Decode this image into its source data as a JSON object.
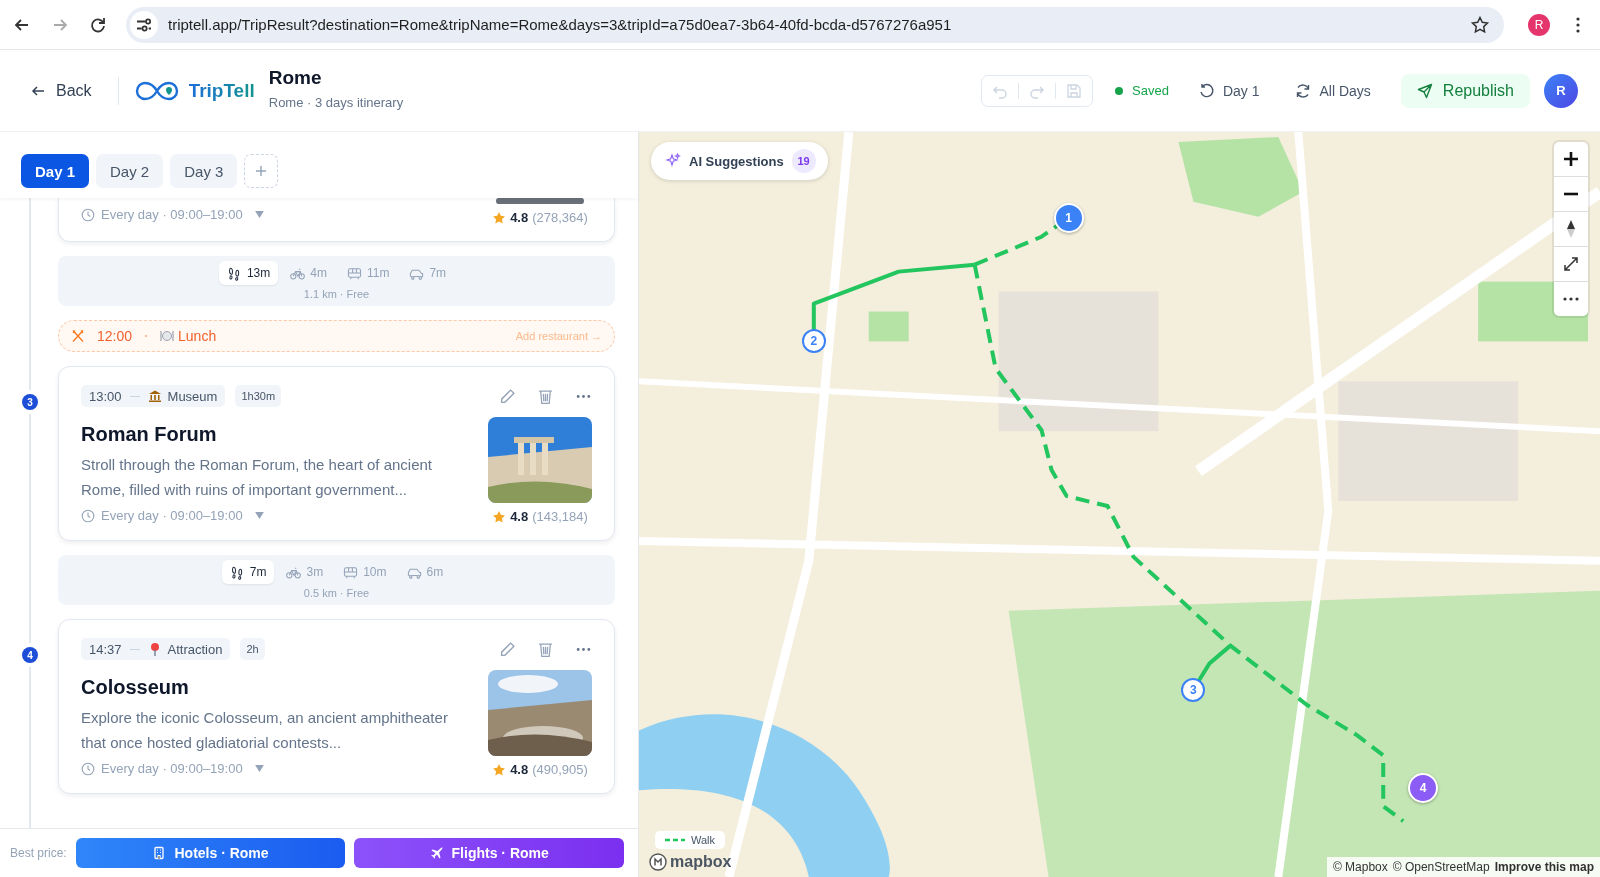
{
  "browser": {
    "url": "triptell.app/TripResult?destination=Rome&tripName=Rome&days=3&tripId=a75d0ea7-3b64-40fd-bcda-d5767276a951",
    "profile": "R"
  },
  "header": {
    "back": "Back",
    "brand": "TripTell",
    "title": "Rome",
    "subtitle": "Rome · 3 days itinerary",
    "saved": "Saved",
    "day": "Day 1",
    "all_days": "All Days",
    "publish": "Republish",
    "avatar": "R"
  },
  "day_tabs": [
    {
      "label": "Day 1",
      "selected": true
    },
    {
      "label": "Day 2",
      "selected": false
    },
    {
      "label": "Day 3",
      "selected": false
    }
  ],
  "itinerary": [
    {
      "kind": "place",
      "hours": "Every day · 09:00–19:00",
      "rating": "4.8",
      "reviews": "(278,364)"
    },
    {
      "kind": "transit",
      "summary": "1.1 km · Free",
      "modes": [
        {
          "kind": "walk",
          "time": "13m",
          "selected": true
        },
        {
          "kind": "bike",
          "time": "4m",
          "selected": false
        },
        {
          "kind": "bus",
          "time": "11m",
          "selected": false
        },
        {
          "kind": "car",
          "time": "7m",
          "selected": false
        }
      ]
    },
    {
      "kind": "meal",
      "time": "12:00",
      "label": "Lunch",
      "action": "Add restaurant →"
    },
    {
      "kind": "place",
      "number": "3",
      "time": "13:00",
      "category": {
        "label": "Museum",
        "kind": "museum"
      },
      "duration": "1h30m",
      "name": "Roman Forum",
      "description": "Stroll through the Roman Forum, the heart of ancient Rome, filled with ruins of important government...",
      "hours": "Every day · 09:00–19:00",
      "rating": "4.8",
      "reviews": "(143,184)"
    },
    {
      "kind": "transit",
      "summary": "0.5 km · Free",
      "modes": [
        {
          "kind": "walk",
          "time": "7m",
          "selected": true
        },
        {
          "kind": "bike",
          "time": "3m",
          "selected": false
        },
        {
          "kind": "bus",
          "time": "10m",
          "selected": false
        },
        {
          "kind": "car",
          "time": "6m",
          "selected": false
        }
      ]
    },
    {
      "kind": "place",
      "number": "4",
      "time": "14:37",
      "category": {
        "label": "Attraction",
        "kind": "attraction"
      },
      "duration": "2h",
      "name": "Colosseum",
      "description": "Explore the iconic Colosseum, an ancient amphitheater that once hosted gladiatorial contests...",
      "hours": "Every day · 09:00–19:00",
      "rating": "4.8",
      "reviews": "(490,905)"
    }
  ],
  "footer": {
    "label": "Best price:",
    "hotels": "Hotels · Rome",
    "flights": "Flights · Rome"
  },
  "map": {
    "ai_label": "AI Suggestions",
    "ai_count": "19",
    "markers": [
      {
        "label": "1",
        "filled": true,
        "color": "#3b82f6"
      },
      {
        "label": "2",
        "filled": false,
        "color": "#3b82f6"
      },
      {
        "label": "3",
        "filled": false,
        "color": "#3b82f6"
      },
      {
        "label": "4",
        "filled": true,
        "color": "#8b5cf6"
      }
    ],
    "legend": "Walk",
    "logo": "mapbox",
    "attribution": [
      "© Mapbox",
      "© OpenStreetMap",
      "Improve this map"
    ]
  }
}
